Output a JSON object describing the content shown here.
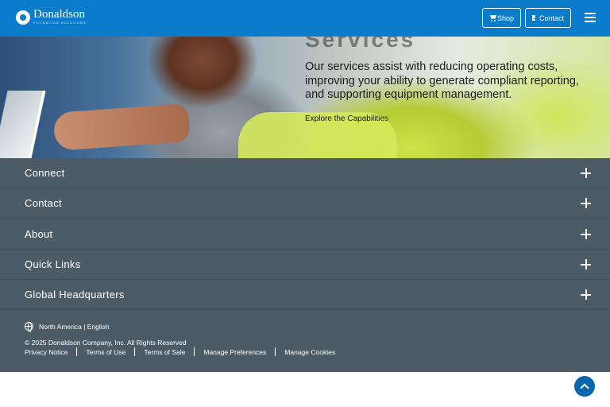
{
  "header": {
    "logo_text": "Donaldson",
    "logo_tagline": "FILTRATION SOLUTIONS",
    "shop_label": "Shop",
    "contact_label": "Contact",
    "icons": [
      "cart-icon",
      "mail-icon",
      "menu-icon"
    ],
    "background_color": "#0a7cc9"
  },
  "hero": {
    "heading_partial": "Services",
    "text": "Our services assist with reducing operating costs, improving your ability to generate compliant reporting, and supporting equipment management.",
    "link_label": "Explore the Capabilities"
  },
  "footer": {
    "background_color": "#4c5b66",
    "accordion": [
      {
        "label": "Connect"
      },
      {
        "label": "Contact"
      },
      {
        "label": "About"
      },
      {
        "label": "Quick Links"
      },
      {
        "label": "Global Headquarters"
      }
    ],
    "region": "North America | English",
    "copyright": "© 2025 Donaldson Company, Inc. All Rights Reserved",
    "legal_links": [
      "Privacy Notice",
      "Terms of Use",
      "Terms of Sale",
      "Manage Preferences",
      "Manage Cookies"
    ]
  },
  "back_to_top": {
    "icon": "chevron-up-icon",
    "color": "#0a66ad"
  }
}
